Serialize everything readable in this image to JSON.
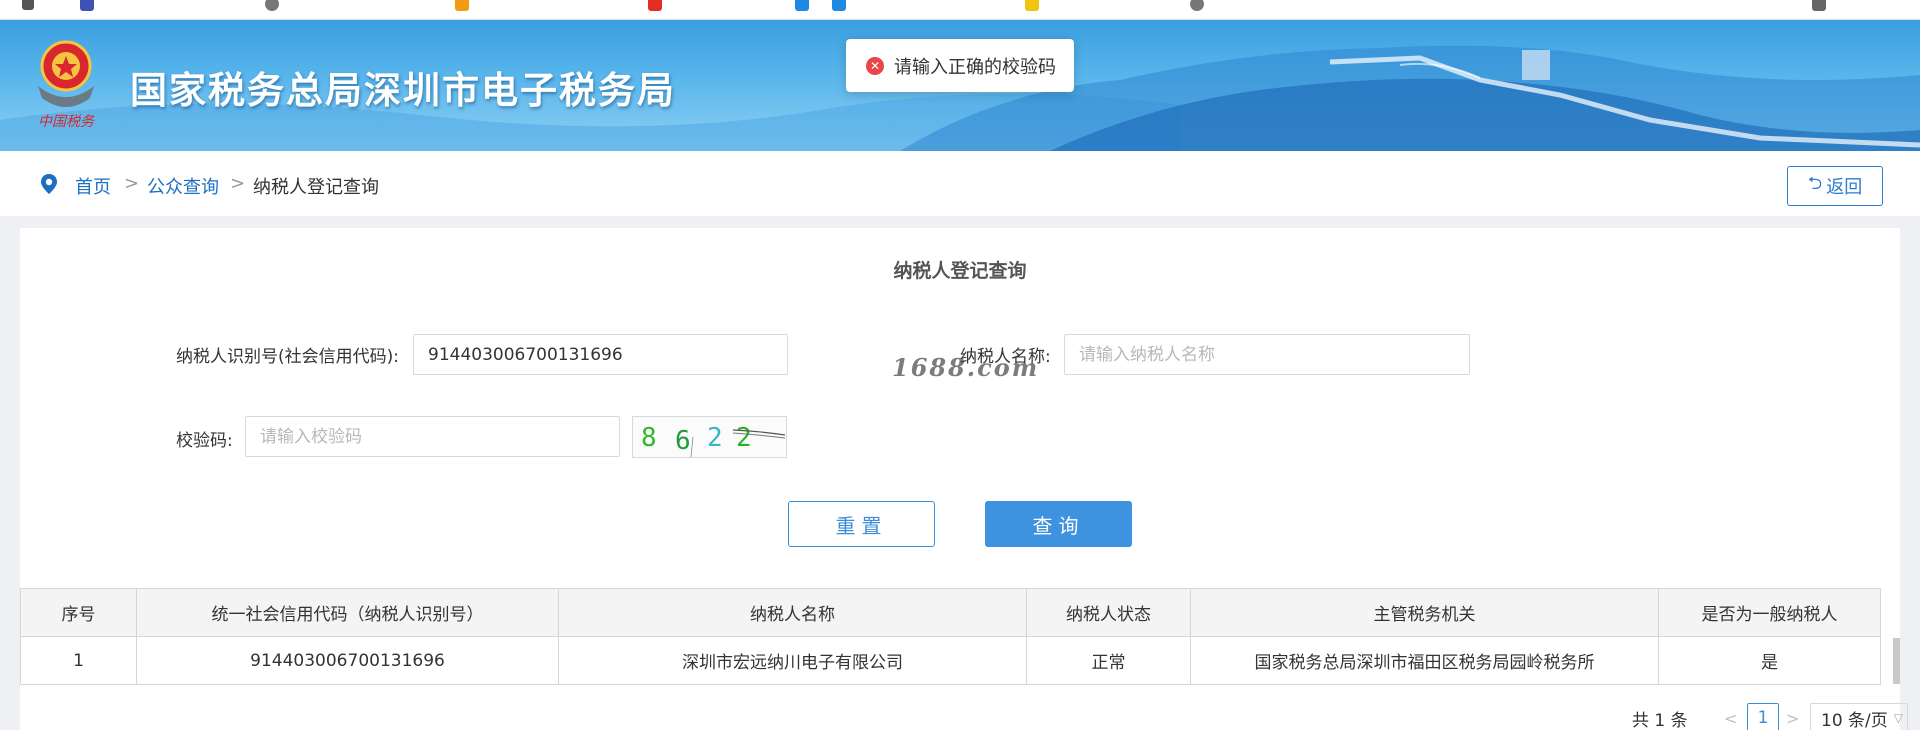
{
  "site": {
    "title": "国家税务总局深圳市电子税务局",
    "emblem_text": "中国税务"
  },
  "toast": {
    "icon": "error-circle-icon",
    "message": "请输入正确的校验码"
  },
  "breadcrumb": {
    "home": "首页",
    "separator": ">",
    "section": "公众查询",
    "current": "纳税人登记查询",
    "back_label": "返回",
    "back_icon": "return-arrow-icon"
  },
  "form": {
    "title": "纳税人登记查询",
    "taxpayer_id_label": "纳税人识别号(社会信用代码):",
    "taxpayer_id_value": "914403006700131696",
    "taxpayer_name_label": "纳税人名称:",
    "taxpayer_name_placeholder": "请输入纳税人名称",
    "captcha_label": "校验码:",
    "captcha_placeholder": "请输入校验码",
    "captcha_digits": [
      "8",
      "6",
      "2",
      "2"
    ],
    "reset_label": "重置",
    "query_label": "查询",
    "watermark": "1688.com"
  },
  "table": {
    "headers": [
      "序号",
      "统一社会信用代码（纳税人识别号）",
      "纳税人名称",
      "纳税人状态",
      "主管税务机关",
      "是否为一般纳税人"
    ],
    "rows": [
      [
        "1",
        "914403006700131696",
        "深圳市宏远纳川电子有限公司",
        "正常",
        "国家税务总局深圳市福田区税务局园岭税务所",
        "是"
      ]
    ]
  },
  "pagination": {
    "total": "共 1 条",
    "prev_icon": "chevron-left-icon",
    "current_page": "1",
    "next_icon": "chevron-right-icon",
    "page_size": "10 条/页",
    "page_size_icon": "chevron-down-icon"
  },
  "colors": {
    "primary": "#3d93df",
    "link": "#1d6fc2",
    "error": "#e8464a",
    "banner": "#3a9fe0"
  }
}
